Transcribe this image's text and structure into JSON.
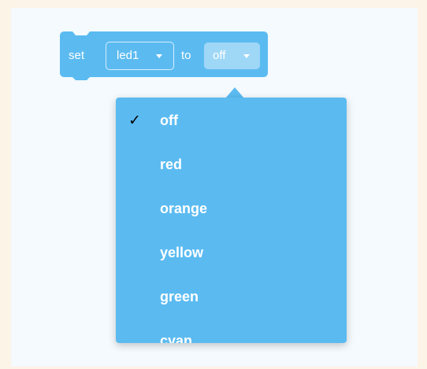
{
  "block": {
    "set_label": "set",
    "target_value": "led1",
    "to_label": "to",
    "color_value": "off"
  },
  "dropdown": {
    "selected_index": 0,
    "check_glyph": "✓",
    "options": [
      {
        "label": "off",
        "selected": true
      },
      {
        "label": "red",
        "selected": false
      },
      {
        "label": "orange",
        "selected": false
      },
      {
        "label": "yellow",
        "selected": false
      },
      {
        "label": "green",
        "selected": false
      },
      {
        "label": "cyan",
        "selected": false
      }
    ]
  },
  "colors": {
    "block": "#5bbbf1",
    "workspace": "#f4fafd",
    "page": "#fdf4e8",
    "checkmark": "#000000"
  }
}
